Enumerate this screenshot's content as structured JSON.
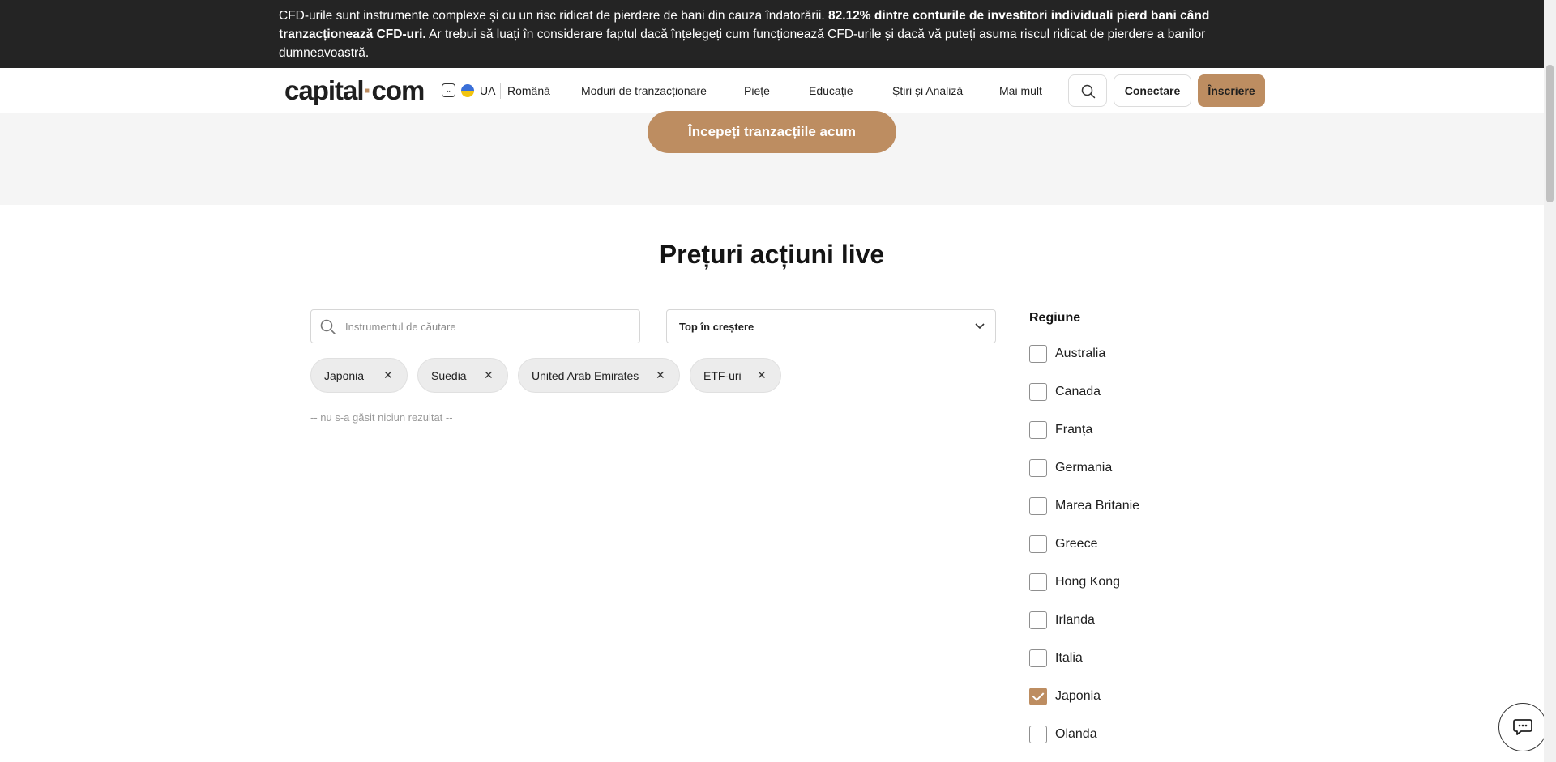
{
  "banner": {
    "text_normal_1": "CFD-urile sunt instrumente complexe și cu un risc ridicat de pierdere de bani din cauza îndatorării. ",
    "text_bold": "82.12% dintre conturile de investitori individuali pierd bani când tranzacționează CFD-uri.",
    "text_normal_2": " Ar trebui să luați în considerare faptul dacă înțelegeți cum funcționează CFD-urile și dacă vă puteți asuma riscul ridicat de pierdere a banilor dumneavoastră."
  },
  "header": {
    "logo_part1": "capital",
    "logo_dot": "·",
    "logo_part2": "com",
    "region_code": "UA",
    "language": "Română",
    "nav": [
      "Moduri de tranzacționare",
      "Piețe",
      "Educație",
      "Știri și Analiză",
      "Mai mult"
    ],
    "login_label": "Conectare",
    "signup_label": "Înscriere"
  },
  "hero": {
    "cta_label": "Începeți tranzacțiile acum"
  },
  "main": {
    "title": "Prețuri acțiuni live",
    "search_placeholder": "Instrumentul de căutare",
    "sort_value": "Top în creștere",
    "chips": [
      "Japonia",
      "Suedia",
      "United Arab Emirates",
      "ETF-uri"
    ],
    "no_results": "-- nu s-a găsit niciun rezultat --"
  },
  "filters": {
    "title": "Regiune",
    "items": [
      {
        "label": "Australia",
        "checked": false
      },
      {
        "label": "Canada",
        "checked": false
      },
      {
        "label": "Franța",
        "checked": false
      },
      {
        "label": "Germania",
        "checked": false
      },
      {
        "label": "Marea Britanie",
        "checked": false
      },
      {
        "label": "Greece",
        "checked": false
      },
      {
        "label": "Hong Kong",
        "checked": false
      },
      {
        "label": "Irlanda",
        "checked": false
      },
      {
        "label": "Italia",
        "checked": false
      },
      {
        "label": "Japonia",
        "checked": true
      },
      {
        "label": "Olanda",
        "checked": false
      }
    ]
  },
  "icons": {
    "search": "search-icon",
    "chevron": "chevron-down-icon",
    "close": "close-icon",
    "chat": "chat-icon",
    "flag": "ukraine-flag-icon"
  },
  "colors": {
    "accent": "#bd8d61",
    "banner_bg": "#242424",
    "hero_bg": "#f5f5f5"
  }
}
